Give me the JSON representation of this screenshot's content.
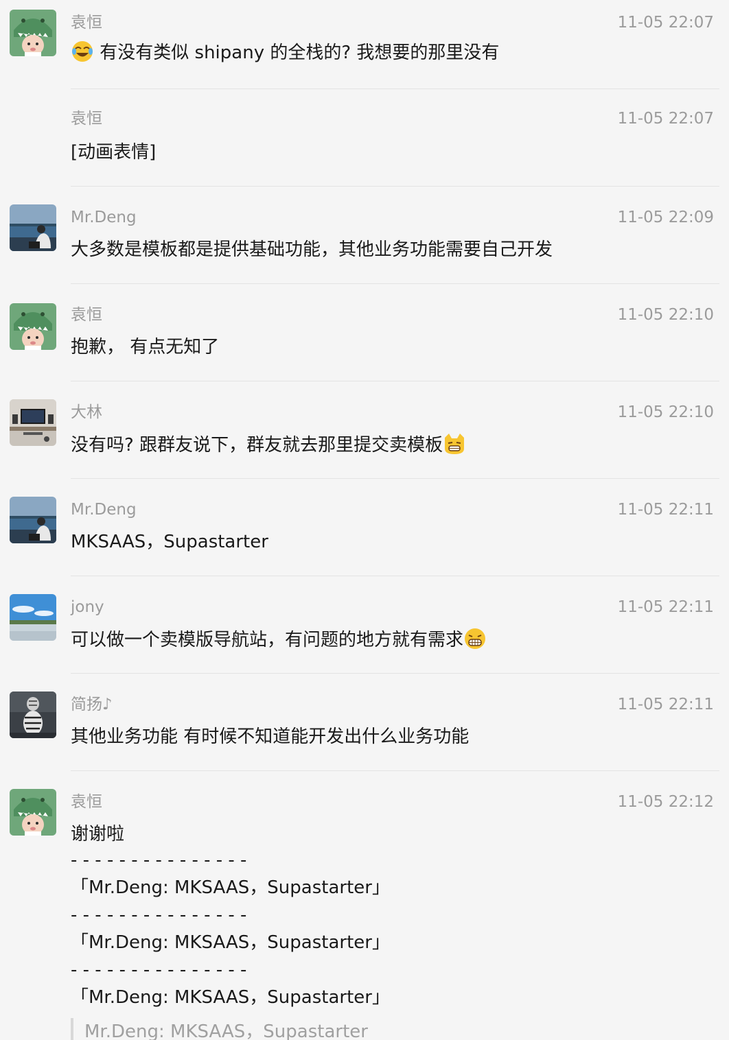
{
  "messages": [
    {
      "sender": "袁恒",
      "time": "11-05 22:07",
      "text": "有没有类似 shipany 的全栈的?  我想要的那里没有",
      "lead_emoji": "joy-emoji",
      "avatar": "dino-avatar"
    },
    {
      "sender": "袁恒",
      "time": "11-05 22:07",
      "text": "[动画表情]"
    },
    {
      "sender": "Mr.Deng",
      "time": "11-05 22:09",
      "text": "大多数是模板都是提供基础功能，其他业务功能需要自己开发",
      "avatar": "lake-avatar"
    },
    {
      "sender": "袁恒",
      "time": "11-05 22:10",
      "text": "抱歉，  有点无知了",
      "avatar": "dino-avatar"
    },
    {
      "sender": "大林",
      "time": "11-05 22:10",
      "text": "没有吗? 跟群友说下，群友就去那里提交卖模板",
      "trail_emoji": "cat-emoji",
      "avatar": "desk-avatar"
    },
    {
      "sender": "Mr.Deng",
      "time": "11-05 22:11",
      "text": "MKSAAS，Supastarter",
      "avatar": "lake-avatar"
    },
    {
      "sender": "jony",
      "time": "11-05 22:11",
      "text": "可以做一个卖模版导航站，有问题的地方就有需求",
      "trail_emoji": "grin-emoji",
      "avatar": "sky-avatar"
    },
    {
      "sender": "简扬♪",
      "time": "11-05 22:11",
      "text": "其他业务功能  有时候不知道能开发出什么业务功能",
      "avatar": "tiger-avatar"
    },
    {
      "sender": "袁恒",
      "time": "11-05 22:12",
      "text": "谢谢啦",
      "avatar": "dino-avatar"
    }
  ],
  "last_message_lines": [
    "- - - - - - - - - - - - - - -",
    "「Mr.Deng: MKSAAS，Supastarter」",
    "- - - - - - - - - - - - - - -",
    "「Mr.Deng: MKSAAS，Supastarter」",
    "- - - - - - - - - - - - - - -",
    "「Mr.Deng: MKSAAS，Supastarter」"
  ],
  "quote_preview": "Mr.Deng: MKSAAS，Supastarter",
  "colors": {
    "background": "#f5f5f5",
    "meta_text": "#9b9b9b",
    "body_text": "#1a1a1a",
    "divider": "#e3e3e3"
  }
}
